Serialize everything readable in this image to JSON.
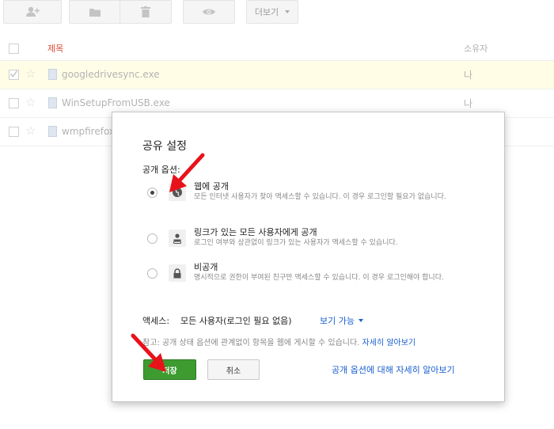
{
  "toolbar": {
    "buttons": [
      {
        "icon": "add-person-icon"
      },
      {
        "icon": "folder-icon"
      },
      {
        "icon": "trash-icon"
      },
      {
        "icon": "eye-icon"
      }
    ],
    "more_label": "더보기"
  },
  "list": {
    "header": {
      "title": "제목",
      "owner": "소유자"
    },
    "rows": [
      {
        "name": "googledrivesync.exe",
        "owner": "나",
        "selected": true
      },
      {
        "name": "WinSetupFromUSB.exe",
        "owner": "나",
        "selected": false
      },
      {
        "name": "wmpfirefoxpl",
        "owner": "",
        "selected": false
      }
    ]
  },
  "dialog": {
    "title": "공유 설정",
    "visibility_label": "공개 옵션:",
    "options": [
      {
        "name": "웹에 공개",
        "desc": "모든 인터넷 사용자가 찾아 액세스할 수 있습니다. 이 경우 로그인할 필요가 없습니다.",
        "icon": "globe-icon",
        "selected": true
      },
      {
        "name": "링크가 있는 모든 사용자에게 공개",
        "desc": "로그인 여부와 상관없이 링크가 있는 사용자가 액세스할 수 있습니다.",
        "icon": "link-user-icon",
        "selected": false
      },
      {
        "name": "비공개",
        "desc": "명시적으로 권한이 부여된 친구만 액세스할 수 있습니다. 이 경우 로그인해야 합니다.",
        "icon": "lock-icon",
        "selected": false
      }
    ],
    "access_label": "액세스:",
    "access_value": "모든 사용자(로그인 필요 없음)",
    "access_level": "보기 가능",
    "note": "참고: 공개 상태 옵션에 관계없이 항목을 웹에 게시할 수 있습니다.",
    "note_link": "자세히 알아보기",
    "save": "저장",
    "cancel": "취소",
    "learn_more": "공개 옵션에 대해 자세히 알아보기"
  },
  "colors": {
    "accent_red": "#dd4b39",
    "link_blue": "#1a5fd0",
    "save_green": "#3d9b2f",
    "arrow_red": "#e8121b"
  }
}
